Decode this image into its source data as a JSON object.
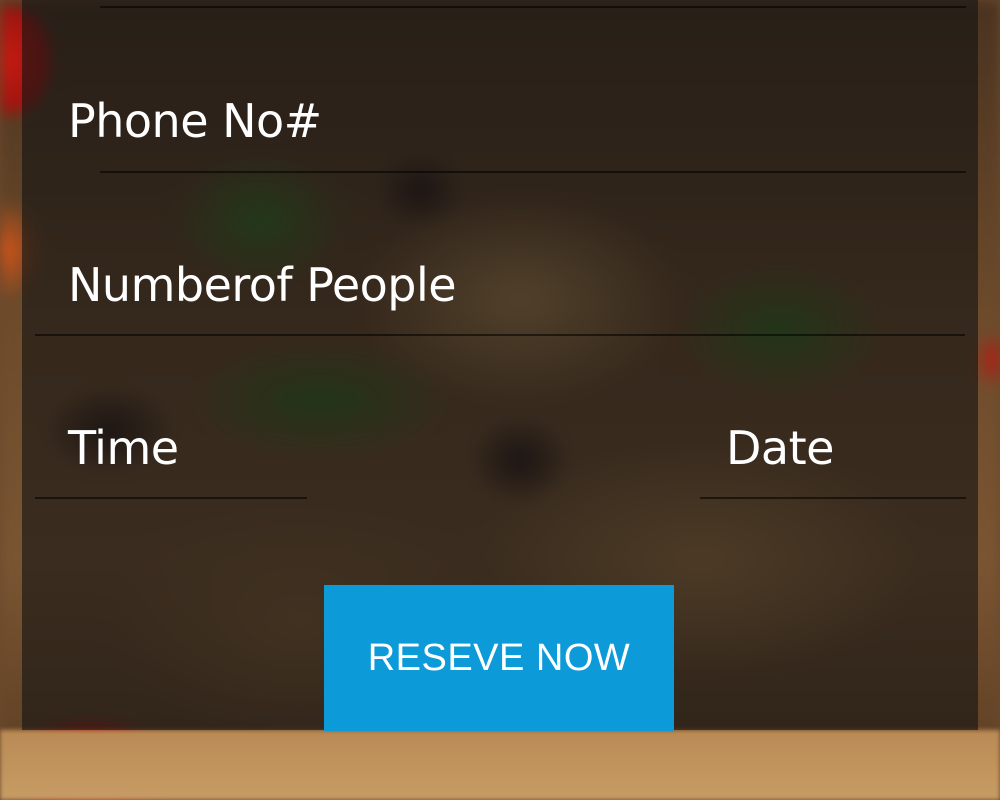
{
  "form": {
    "phone_placeholder": "Phone No#",
    "people_placeholder": "Numberof People",
    "time_placeholder": "Time",
    "date_placeholder": "Date"
  },
  "actions": {
    "reserve_label": "RESEVE NOW"
  },
  "colors": {
    "button_accent": "#0d9ad8",
    "overlay": "#141414",
    "text": "#ffffff"
  }
}
